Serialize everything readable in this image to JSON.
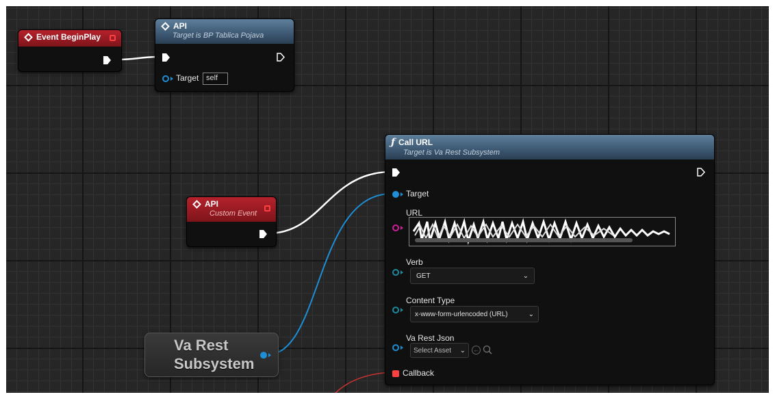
{
  "nodes": {
    "event_begin_play": {
      "title": "Event BeginPlay"
    },
    "api_call": {
      "title": "API",
      "subtitle": "Target is BP Tablica Pojava",
      "target_label": "Target",
      "target_value": "self"
    },
    "api_custom_event": {
      "title": "API",
      "subtitle": "Custom Event"
    },
    "call_url": {
      "title": "Call URL",
      "subtitle": "Target is Va Rest Subsystem",
      "target_label": "Target",
      "url_label": "URL",
      "verb_label": "Verb",
      "verb_value": "GET",
      "content_type_label": "Content Type",
      "content_type_value": "x-www-form-urlencoded (URL)",
      "json_label": "Va Rest Json",
      "json_value": "Select Asset",
      "callback_label": "Callback"
    },
    "subsystem_getter": {
      "line1": "Va Rest",
      "line2": "Subsystem"
    }
  },
  "icons": {
    "event": "diamond-icon",
    "function": "function-f-icon",
    "delegate": "red-square-icon",
    "asset_actions": [
      "use-selected-asset-icon",
      "browse-search-icon"
    ]
  },
  "colors": {
    "event_header": "#b5222c",
    "function_header": "#3d5872",
    "exec_wire": "#ffffff",
    "object_wire": "#1e8fd6",
    "string_pin": "#d21e9c",
    "struct_pin": "#1e8aa2",
    "delegate_wire": "#c83232"
  }
}
